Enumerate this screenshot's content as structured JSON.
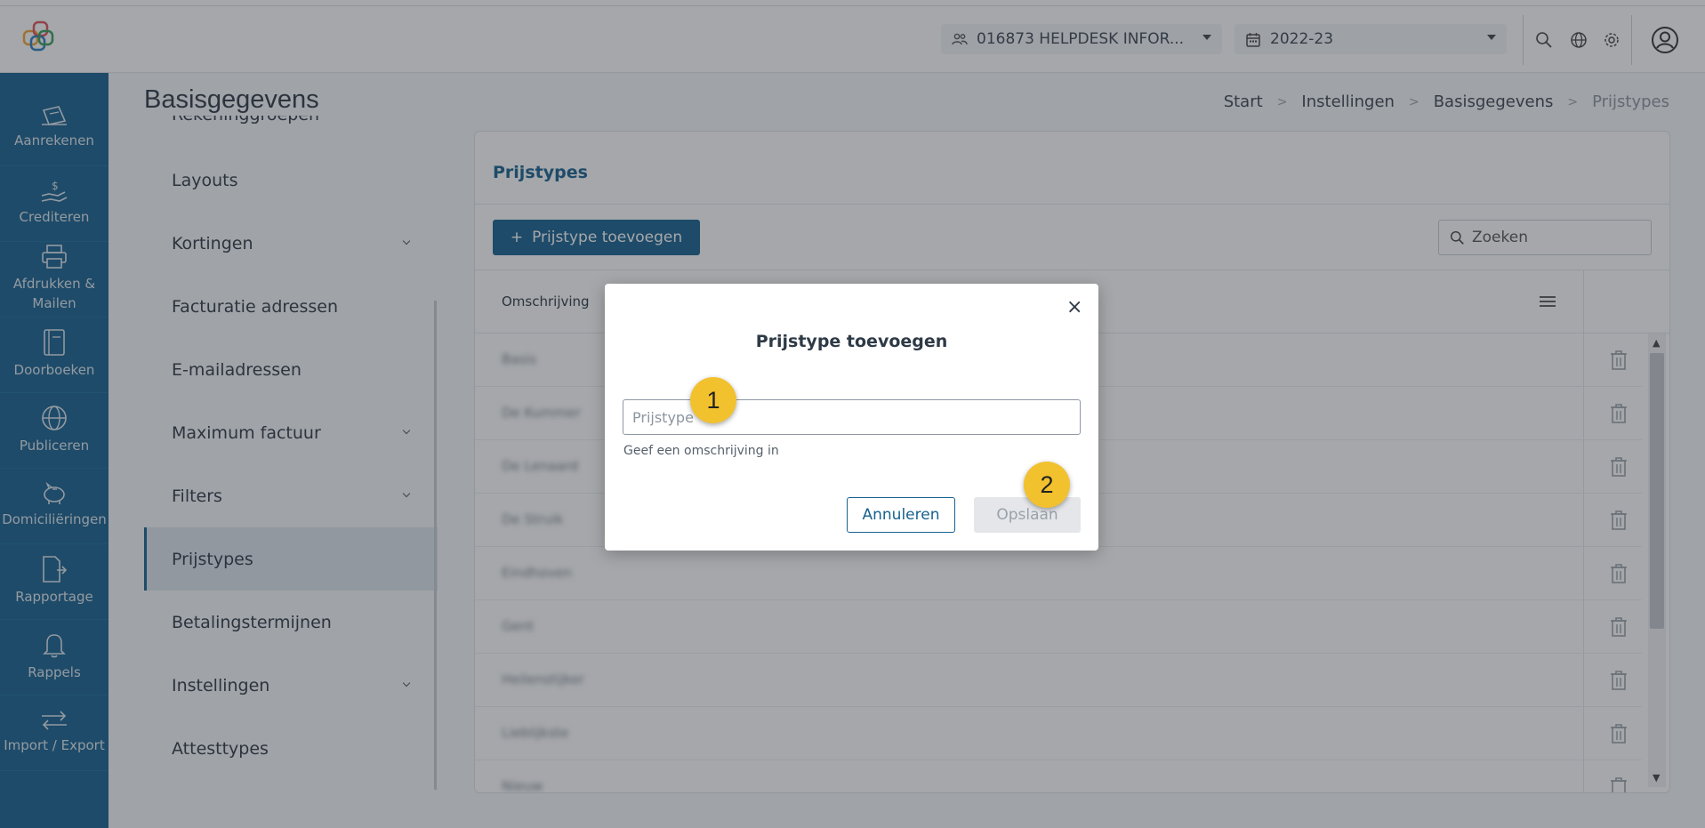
{
  "header": {
    "org_selector": "016873 HELPDESK INFOR...",
    "year_selector": "2022-23",
    "icons": [
      "search-icon",
      "globe-icon",
      "gear-icon",
      "user-icon"
    ]
  },
  "sidebar": {
    "items": [
      {
        "label": "Aanrekenen",
        "icon": "invoice-icon"
      },
      {
        "label": "Crediteren",
        "icon": "hand-money-icon"
      },
      {
        "label": "Afdrukken & Mailen",
        "icon": "printer-icon"
      },
      {
        "label": "Doorboeken",
        "icon": "book-icon"
      },
      {
        "label": "Publiceren",
        "icon": "globe-icon"
      },
      {
        "label": "Domiciliëringen",
        "icon": "piggy-bank-icon"
      },
      {
        "label": "Rapportage",
        "icon": "report-icon"
      },
      {
        "label": "Rappels",
        "icon": "bell-icon"
      },
      {
        "label": "Import / Export",
        "icon": "swap-arrows-icon"
      }
    ]
  },
  "page": {
    "title": "Basisgegevens",
    "breadcrumb": [
      "Start",
      "Instellingen",
      "Basisgegevens",
      "Prijstypes"
    ]
  },
  "subnav": {
    "partial_top": "Rekeninggroepen",
    "items": [
      {
        "label": "Layouts",
        "expandable": false,
        "active": false
      },
      {
        "label": "Kortingen",
        "expandable": true,
        "active": false
      },
      {
        "label": "Facturatie adressen",
        "expandable": false,
        "active": false
      },
      {
        "label": "E-mailadressen",
        "expandable": false,
        "active": false
      },
      {
        "label": "Maximum factuur",
        "expandable": true,
        "active": false
      },
      {
        "label": "Filters",
        "expandable": true,
        "active": false
      },
      {
        "label": "Prijstypes",
        "expandable": false,
        "active": true
      },
      {
        "label": "Betalingstermijnen",
        "expandable": false,
        "active": false
      },
      {
        "label": "Instellingen",
        "expandable": true,
        "active": false
      },
      {
        "label": "Attesttypes",
        "expandable": false,
        "active": false
      }
    ]
  },
  "card": {
    "title": "Prijstypes",
    "add_button": "Prijstype toevoegen",
    "search_placeholder": "Zoeken",
    "column_header": "Omschrijving",
    "rows": [
      "Basis",
      "De Kummer",
      "De Lenaard",
      "De Struik",
      "Eindhoven",
      "Gent",
      "Heilenstijker",
      "Lieblijkste",
      "Nieuw"
    ]
  },
  "modal": {
    "title": "Prijstype toevoegen",
    "input_placeholder": "Prijstype",
    "input_value": "",
    "hint": "Geef een omschrijving in",
    "cancel_label": "Annuleren",
    "save_label": "Opslaan",
    "close_symbol": "×"
  },
  "markers": [
    "1",
    "2"
  ],
  "colors": {
    "primary": "#17618f",
    "marker": "#f2c12e",
    "disabled_bg": "#e4e6e9"
  }
}
